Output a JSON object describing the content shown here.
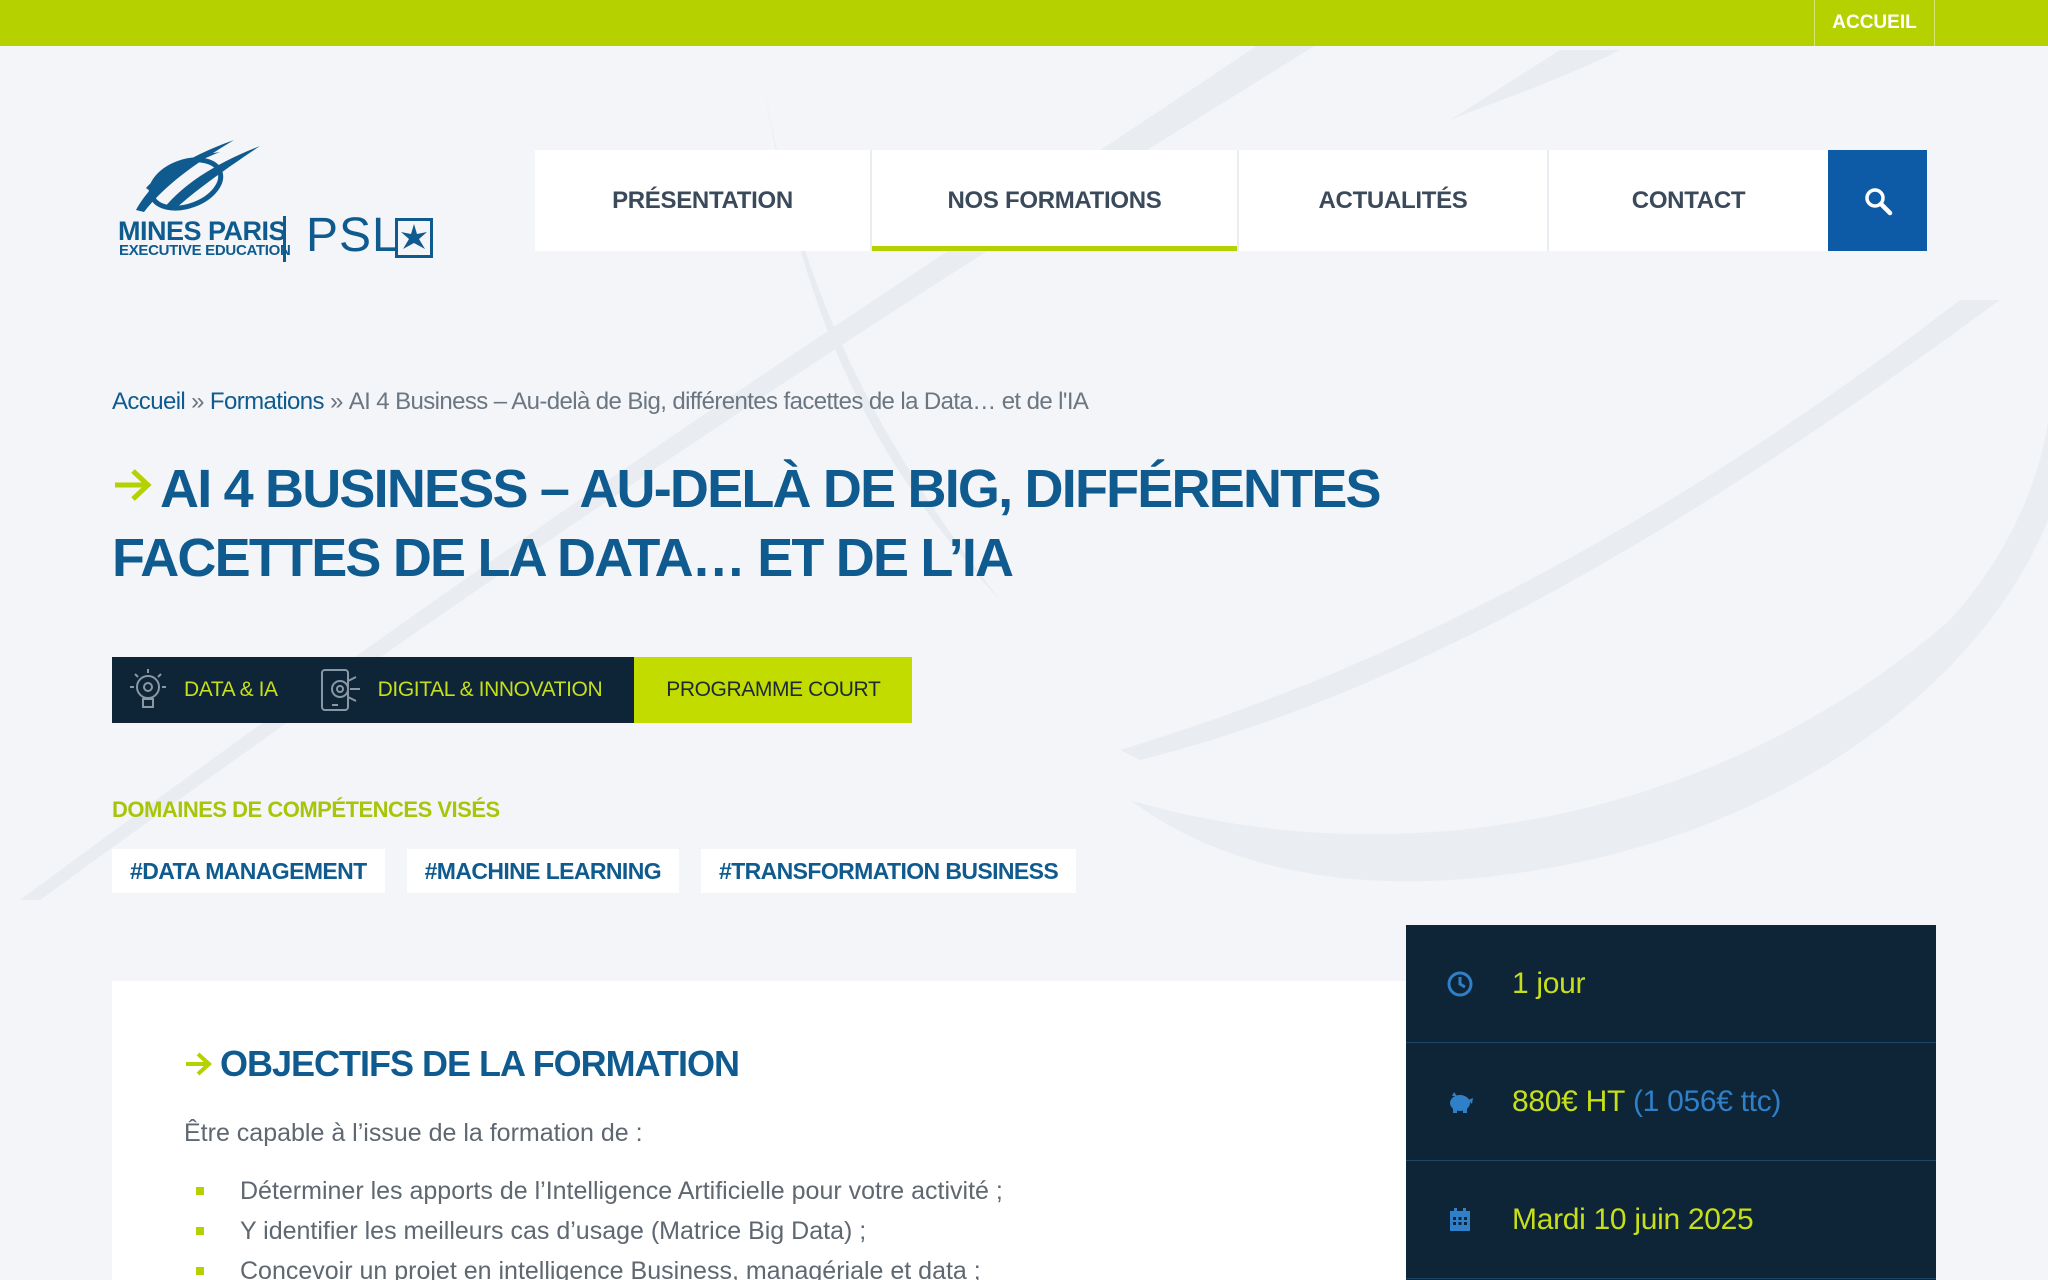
{
  "topbar": {
    "home_label": "ACCUEIL"
  },
  "logo": {
    "line1": "MINES PARIS",
    "line2": "EXECUTIVE EDUCATION",
    "psl": "PSL"
  },
  "nav": {
    "items": [
      {
        "label": "PRÉSENTATION",
        "active": false
      },
      {
        "label": "NOS FORMATIONS",
        "active": true
      },
      {
        "label": "ACTUALITÉS",
        "active": false
      },
      {
        "label": "CONTACT",
        "active": false
      }
    ],
    "search_icon": "search-icon"
  },
  "breadcrumb": {
    "home": "Accueil",
    "separator": "»",
    "formations": "Formations",
    "current": "AI 4 Business – Au-delà de Big, différentes facettes de la Data… et de l'IA"
  },
  "page": {
    "title": "AI 4 Business – Au-delà de Big, différentes facettes de la Data… et de l’IA"
  },
  "tags": {
    "categories": [
      {
        "label": "DATA & IA",
        "icon": "lightbulb-gear-icon"
      },
      {
        "label": "DIGITAL & INNOVATION",
        "icon": "tablet-gear-icon"
      }
    ],
    "program_type": "PROGRAMME COURT"
  },
  "competences": {
    "title": "DOMAINES DE COMPÉTENCES VISÉS",
    "chips": [
      "#DATA MANAGEMENT",
      "#MACHINE LEARNING",
      "#TRANSFORMATION BUSINESS"
    ]
  },
  "objectives": {
    "title": "OBJECTIFS DE LA FORMATION",
    "intro": "Être capable à l’issue de la formation de :",
    "items": [
      "Déterminer les apports de l’Intelligence Artificielle pour votre activité ;",
      "Y identifier les meilleurs cas d’usage (Matrice Big Data) ;",
      "Concevoir un projet en intelligence Business, managériale et data ;"
    ]
  },
  "info": {
    "duration": "1 jour",
    "price_ht": "880€ HT",
    "price_ttc": "(1 056€ ttc)",
    "date": "Mardi 10 juin 2025",
    "icons": [
      "clock-icon",
      "piggy-bank-icon",
      "calendar-icon"
    ]
  },
  "colors": {
    "brand_blue": "#0f5b8f",
    "accent_green": "#b5d100",
    "dark_navy": "#0d2537",
    "search_blue": "#0d5aa7"
  }
}
